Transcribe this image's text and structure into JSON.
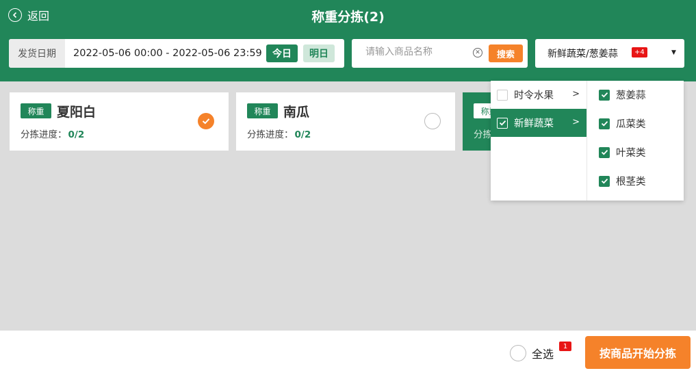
{
  "header": {
    "back_label": "返回",
    "title": "称重分拣(2)"
  },
  "filters": {
    "date_label": "发货日期",
    "date_range": "2022-05-06 00:00  -  2022-05-06 23:59",
    "today_label": "今日",
    "tomorrow_label": "明日",
    "search_placeholder": "请输入商品名称",
    "search_value": "",
    "search_button": "搜索",
    "category_selected": "新鲜蔬菜/葱姜蒜",
    "category_more_badge": "+4"
  },
  "cards": [
    {
      "tag": "称重",
      "name": "夏阳白",
      "progress_label": "分拣进度：",
      "progress_value": "0/2",
      "checked": true
    },
    {
      "tag": "称重",
      "name": "南瓜",
      "progress_label": "分拣进度：",
      "progress_value": "0/2",
      "checked": false
    },
    {
      "tag": "称重",
      "name": "",
      "progress_label": "分拣",
      "progress_value": "",
      "checked": false
    }
  ],
  "dropdown": {
    "categories": [
      {
        "label": "时令水果",
        "checked": false,
        "active": false
      },
      {
        "label": "新鲜蔬菜",
        "checked": true,
        "active": true
      }
    ],
    "subcategories": [
      {
        "label": "葱姜蒜",
        "checked": true
      },
      {
        "label": "瓜菜类",
        "checked": true
      },
      {
        "label": "叶菜类",
        "checked": true
      },
      {
        "label": "根茎类",
        "checked": true
      }
    ]
  },
  "footer": {
    "select_all_label": "全选",
    "selected_count": "1",
    "start_button": "按商品开始分拣"
  },
  "colors": {
    "primary": "#218659",
    "accent": "#f5822a",
    "badge": "#e81515",
    "background": "#dcdcdc"
  }
}
